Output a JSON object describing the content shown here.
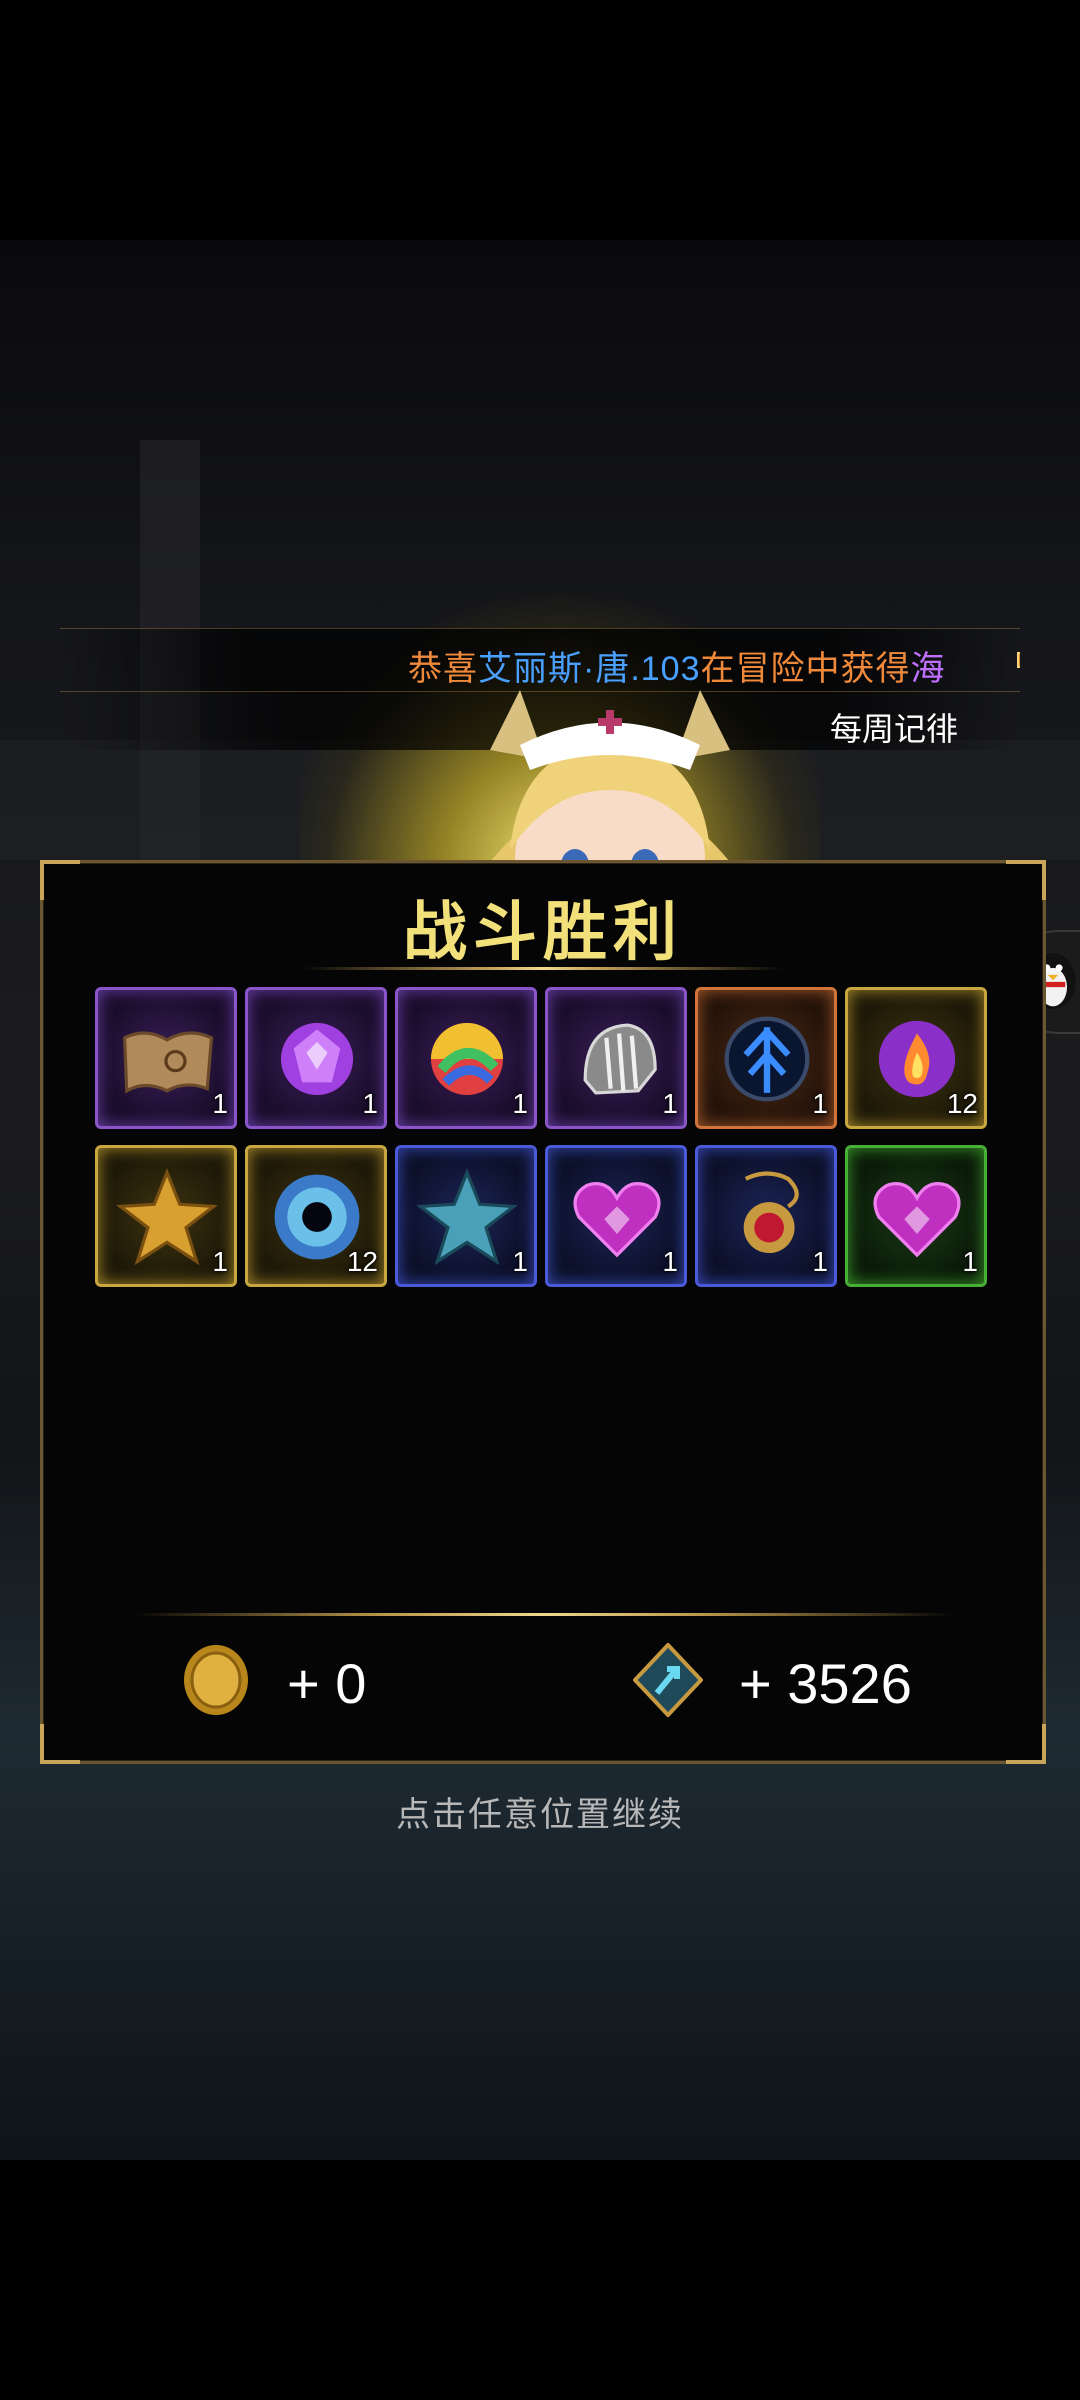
{
  "ticker": {
    "segments": [
      {
        "text": "恭喜",
        "color": "#f08a3a"
      },
      {
        "text": "艾丽斯·唐.103",
        "color": "#4aa0ff"
      },
      {
        "text": "在冒险中获得",
        "color": "#f08a3a"
      },
      {
        "text": "海",
        "color": "#c070ff"
      }
    ],
    "second_line": "每周记徘"
  },
  "result": {
    "title": "战斗胜利",
    "continue_hint": "点击任意位置继续"
  },
  "rewards": {
    "items": [
      {
        "icon": "map-scroll-icon",
        "quality": "purple",
        "count": "1"
      },
      {
        "icon": "purple-gem-icon",
        "quality": "purple",
        "count": "1"
      },
      {
        "icon": "rainbow-orb-icon",
        "quality": "purple",
        "count": "1"
      },
      {
        "icon": "silver-helmet-icon",
        "quality": "purple",
        "count": "1"
      },
      {
        "icon": "blue-rune-icon",
        "quality": "orange",
        "count": "1"
      },
      {
        "icon": "fire-orb-icon",
        "quality": "gold",
        "count": "12"
      },
      {
        "icon": "gold-star-icon",
        "quality": "gold",
        "count": "1"
      },
      {
        "icon": "void-eye-icon",
        "quality": "gold",
        "count": "12"
      },
      {
        "icon": "blue-star-icon",
        "quality": "blue",
        "count": "1"
      },
      {
        "icon": "purple-heart-icon",
        "quality": "blue",
        "count": "1"
      },
      {
        "icon": "ruby-amulet-icon",
        "quality": "blue",
        "count": "1"
      },
      {
        "icon": "purple-heart-icon",
        "quality": "green",
        "count": "1"
      }
    ],
    "gold": "+ 0",
    "exp": "+ 3526"
  },
  "colors": {
    "title": "#f2e07a",
    "panel_border": "#6a5630",
    "accent_gold": "#c9a55a"
  }
}
